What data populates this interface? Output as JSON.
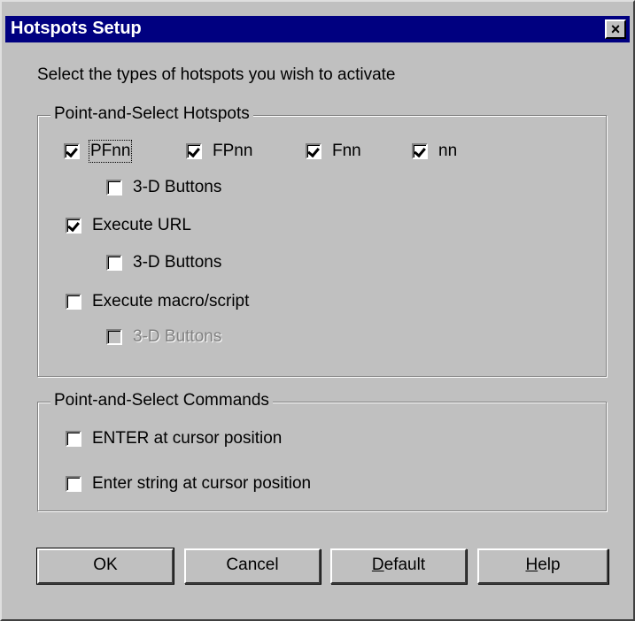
{
  "window": {
    "title": "Hotspots Setup",
    "close_glyph": "×"
  },
  "intro": "Select the types of hotspots you wish to activate",
  "hotspots_group": {
    "label": "Point-and-Select Hotspots",
    "pf_options": [
      {
        "label": "PFnn",
        "checked": true
      },
      {
        "label": "FPnn",
        "checked": true
      },
      {
        "label": "Fnn",
        "checked": true
      },
      {
        "label": "nn",
        "checked": true
      }
    ],
    "pf_3d": {
      "label": "3-D Buttons",
      "checked": false
    },
    "execute_url": {
      "label": "Execute URL",
      "checked": true
    },
    "url_3d": {
      "label": "3-D Buttons",
      "checked": false
    },
    "execute_macro": {
      "label": "Execute macro/script",
      "checked": false
    },
    "macro_3d": {
      "label": "3-D Buttons",
      "checked": false,
      "disabled": true
    }
  },
  "commands_group": {
    "label": "Point-and-Select Commands",
    "enter_cursor": {
      "label": "ENTER at cursor position",
      "checked": false
    },
    "enter_string": {
      "label": "Enter string at cursor position",
      "checked": false
    }
  },
  "buttons": {
    "ok": "OK",
    "cancel": "Cancel",
    "default_first": "D",
    "default_rest": "efault",
    "help_first": "H",
    "help_rest": "elp"
  }
}
